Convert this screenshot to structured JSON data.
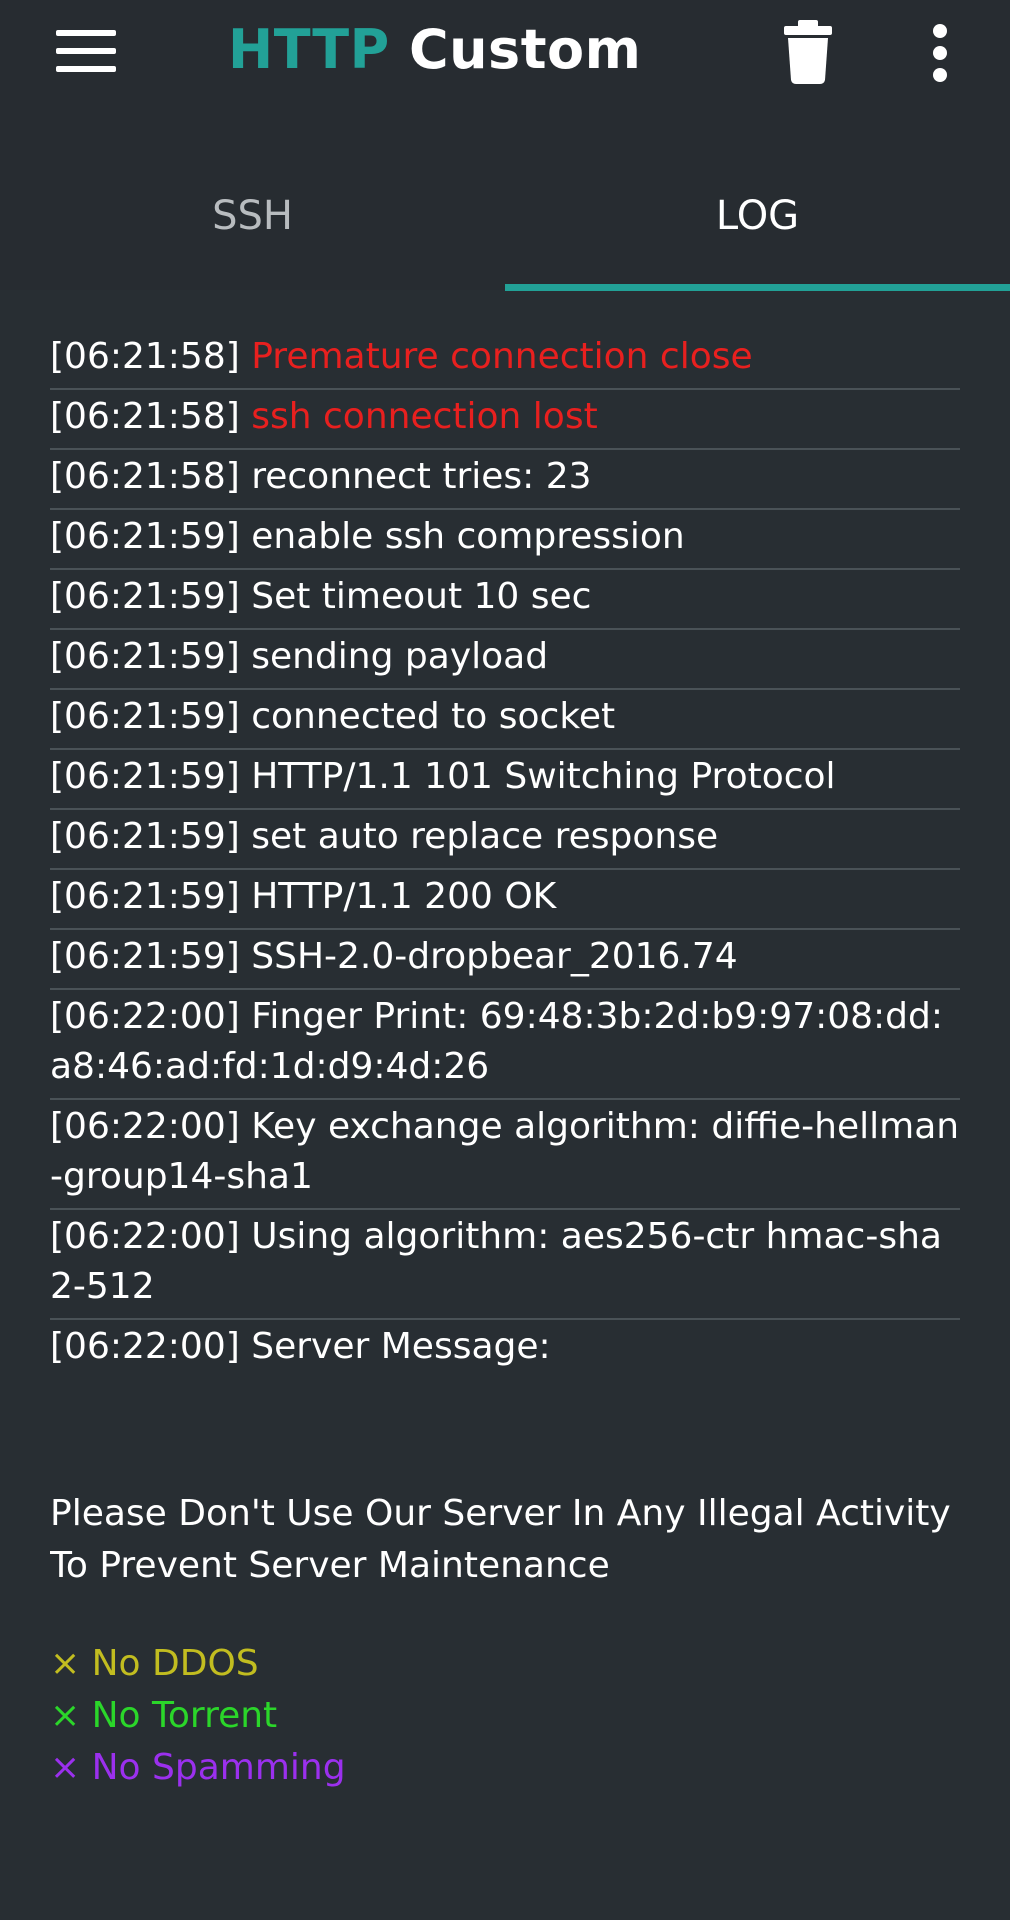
{
  "header": {
    "title_accent": "HTTP",
    "title_rest": " Custom",
    "menu_icon": "hamburger-icon",
    "trash_icon": "trash-icon",
    "more_icon": "more-vertical-icon",
    "accent_color": "#22a197"
  },
  "tabs": {
    "ssh_label": "SSH",
    "log_label": "LOG",
    "active": "LOG"
  },
  "log": {
    "entries": [
      {
        "ts": "[06:21:58]",
        "msg": "Premature connection close",
        "color": "#e8201f"
      },
      {
        "ts": "[06:21:58]",
        "msg": "ssh connection lost",
        "color": "#e8201f"
      },
      {
        "ts": "[06:21:58]",
        "msg": "reconnect tries: 23"
      },
      {
        "ts": "[06:21:59]",
        "msg": "enable ssh compression"
      },
      {
        "ts": "[06:21:59]",
        "msg": "Set timeout 10 sec"
      },
      {
        "ts": "[06:21:59]",
        "msg": "sending payload"
      },
      {
        "ts": "[06:21:59]",
        "msg": "connected to socket"
      },
      {
        "ts": "[06:21:59]",
        "msg": "HTTP/1.1 101 Switching Protocol"
      },
      {
        "ts": "[06:21:59]",
        "msg": "set auto replace response"
      },
      {
        "ts": "[06:21:59]",
        "msg": "HTTP/1.1 200 OK"
      },
      {
        "ts": "[06:21:59]",
        "msg": "SSH-2.0-dropbear_2016.74"
      },
      {
        "ts": "[06:22:00]",
        "msg": "Finger Print: 69:48:3b:2d:b9:97:08:dd:a8:46:ad:fd:1d:d9:4d:26"
      },
      {
        "ts": "[06:22:00]",
        "msg": "Key exchange algorithm: diffie-hellman-group14-sha1"
      },
      {
        "ts": "[06:22:00]",
        "msg": "Using algorithm: aes256-ctr hmac-sha2-512"
      },
      {
        "ts": "[06:22:00]",
        "msg": "Server Message:"
      }
    ],
    "server_message": "Please Don't Use Our Server In Any Illegal Activity To Prevent Server Maintenance",
    "rules": [
      {
        "text": "× No DDOS",
        "color": "#c2bd20"
      },
      {
        "text": "× No Torrent",
        "color": "#2bd62a"
      },
      {
        "text": "× No Spamming",
        "color": "#9b30ee"
      }
    ]
  }
}
